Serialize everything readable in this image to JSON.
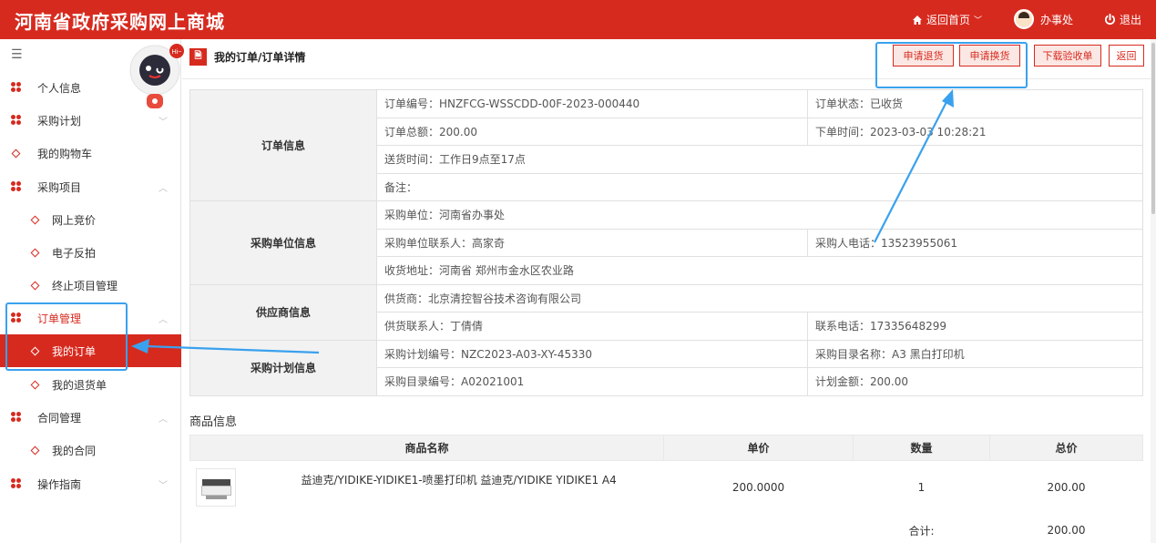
{
  "header": {
    "title": "河南省政府采购网上商城",
    "home_link": "返回首页",
    "user": "办事处",
    "logout": "退出"
  },
  "sidebar": {
    "items": [
      {
        "label": "个人信息",
        "icon": "clover-icon",
        "expandable": false
      },
      {
        "label": "采购计划",
        "icon": "clover-icon",
        "expandable": true,
        "state": "collapsed"
      },
      {
        "label": "我的购物车",
        "icon": "diamond-icon"
      },
      {
        "label": "采购项目",
        "icon": "clover-icon",
        "expandable": true,
        "state": "expanded"
      },
      {
        "label": "网上竞价",
        "icon": "diamond-icon"
      },
      {
        "label": "电子反拍",
        "icon": "diamond-icon"
      },
      {
        "label": "终止项目管理",
        "icon": "diamond-icon"
      },
      {
        "label": "订单管理",
        "icon": "clover-icon",
        "expandable": true,
        "state": "expanded"
      },
      {
        "label": "我的订单",
        "icon": "diamond-icon",
        "active": true
      },
      {
        "label": "我的退货单",
        "icon": "diamond-icon"
      },
      {
        "label": "合同管理",
        "icon": "clover-icon",
        "expandable": true,
        "state": "expanded"
      },
      {
        "label": "我的合同",
        "icon": "diamond-icon"
      },
      {
        "label": "操作指南",
        "icon": "clover-icon",
        "expandable": true,
        "state": "collapsed"
      }
    ]
  },
  "assistant": {
    "badge": "Hi~"
  },
  "breadcrumb": "我的订单/订单详情",
  "actions": {
    "return_goods": "申请退货",
    "exchange_goods": "申请换货",
    "download_receipt": "下载验收单",
    "back": "返回"
  },
  "order_info": {
    "section": "订单信息",
    "order_no": "订单编号：HNZFCG-WSSCDD-00F-2023-000440",
    "order_status": "订单状态：已收货",
    "total": "订单总额：200.00",
    "order_time": "下单时间：2023-03-03 10:28:21",
    "delivery_time": "送货时间：工作日9点至17点",
    "remark": "备注："
  },
  "buyer_info": {
    "section": "采购单位信息",
    "unit": "采购单位：河南省办事处",
    "contact": "采购单位联系人：高家奇",
    "phone": "采购人电话：13523955061",
    "address": "收货地址：河南省 郑州市金水区农业路"
  },
  "supplier_info": {
    "section": "供应商信息",
    "supplier": "供货商：北京清控智谷技术咨询有限公司",
    "contact": "供货联系人：丁倩倩",
    "phone": "联系电话：17335648299"
  },
  "plan_info": {
    "section": "采购计划信息",
    "plan_no": "采购计划编号：NZC2023-A03-XY-45330",
    "catalog_name": "采购目录名称：A3 黑白打印机",
    "catalog_no": "采购目录编号：A02021001",
    "plan_amount": "计划金额：200.00"
  },
  "goods": {
    "title": "商品信息",
    "columns": [
      "商品名称",
      "单价",
      "数量",
      "总价"
    ],
    "rows": [
      {
        "name": "益迪克/YIDIKE-YIDIKE1-喷墨打印机 益迪克/YIDIKE YIDIKE1 A4",
        "price": "200.0000",
        "qty": "1",
        "total": "200.00",
        "image": "printer-image"
      }
    ],
    "sum_label": "合计:",
    "sum_value": "200.00"
  },
  "colors": {
    "brand": "#d72a1f",
    "highlight": "#3aa1ee"
  }
}
